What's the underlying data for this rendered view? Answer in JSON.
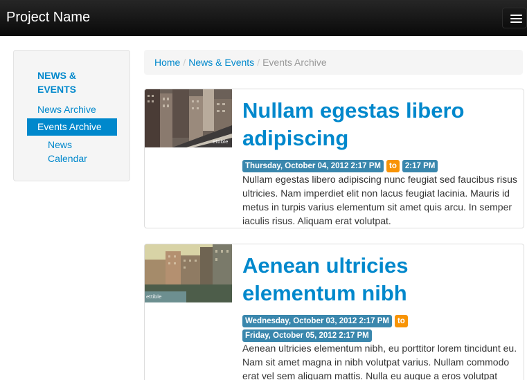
{
  "navbar": {
    "brand": "Project Name"
  },
  "sidebar": {
    "heading": "NEWS & EVENTS",
    "items": [
      {
        "label": "News Archive",
        "active": false
      },
      {
        "label": "Events Archive",
        "active": true
      },
      {
        "label": "News Calendar",
        "active": false
      }
    ]
  },
  "breadcrumb": {
    "home": "Home",
    "section": "News & Events",
    "current": "Events Archive",
    "separator": "/"
  },
  "posts": [
    {
      "title": "Nullam egestas libero adipiscing",
      "start": "Thursday, October 04, 2012 2:17 PM",
      "to": "to",
      "end": "2:17 PM",
      "body": "Nullam egestas libero adipiscing nunc feugiat sed faucibus risus ultricies. Nam imperdiet elit non lacus feugiat lacinia. Mauris id metus in turpis varius elementum sit amet quis arcu. In semper iaculis risus. Aliquam erat volutpat.",
      "thumb_caption": "ettible"
    },
    {
      "title": "Aenean ultricies elementum nibh",
      "start": "Wednesday, October 03, 2012 2:17 PM",
      "to": "to",
      "end": "Friday, October 05, 2012 2:17 PM",
      "body": "Aenean ultricies elementum nibh, eu porttitor lorem tincidunt eu. Nam sit amet magna in nibh volutpat varius. Nullam commodo erat vel sem aliquam mattis. Nulla eu augue a eros volutpat",
      "thumb_caption": "ettible"
    }
  ],
  "colors": {
    "link": "#0088cc",
    "info": "#3a87ad",
    "warning": "#f89406",
    "navbar": "#111111"
  },
  "icons": {
    "menu": "hamburger-menu-icon"
  }
}
